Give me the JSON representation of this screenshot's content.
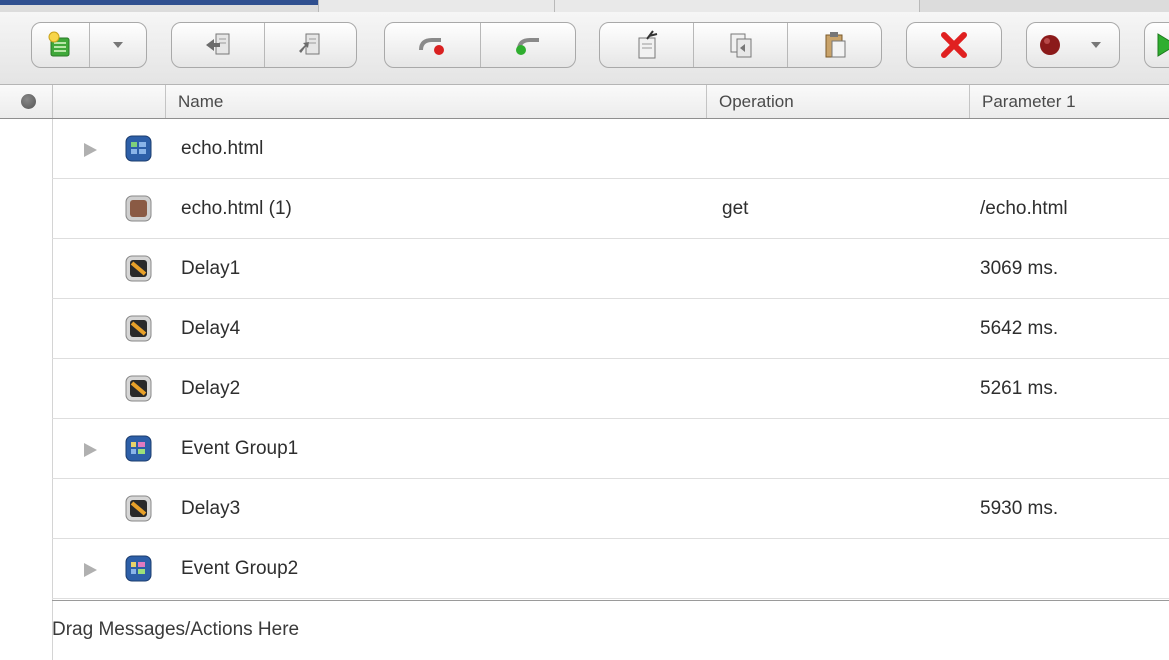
{
  "columns": {
    "name": "Name",
    "operation": "Operation",
    "parameter1": "Parameter 1"
  },
  "toolbar": {
    "groups": [
      [
        "new-item-icon",
        "dropdown-arrow-icon"
      ],
      [
        "import-icon",
        "export-icon"
      ],
      [
        "red-dot-connector-icon",
        "green-dot-connector-icon"
      ],
      [
        "cut-icon",
        "copy-icon",
        "paste-icon"
      ],
      [
        "delete-icon"
      ],
      [
        "record-icon",
        "dropdown-arrow-icon"
      ],
      [
        "play-icon"
      ]
    ]
  },
  "rows": [
    {
      "name": "echo.html",
      "operation": "",
      "parameter1": "",
      "type": "group",
      "expandable": true
    },
    {
      "name": "echo.html (1)",
      "operation": "get",
      "parameter1": "/echo.html",
      "type": "message",
      "expandable": false
    },
    {
      "name": "Delay1",
      "operation": "",
      "parameter1": "3069 ms.",
      "type": "delay",
      "expandable": false
    },
    {
      "name": "Delay4",
      "operation": "",
      "parameter1": "5642 ms.",
      "type": "delay",
      "expandable": false
    },
    {
      "name": "Delay2",
      "operation": "",
      "parameter1": "5261 ms.",
      "type": "delay",
      "expandable": false
    },
    {
      "name": "Event Group1",
      "operation": "",
      "parameter1": "",
      "type": "event-group",
      "expandable": true
    },
    {
      "name": "Delay3",
      "operation": "",
      "parameter1": "5930 ms.",
      "type": "delay",
      "expandable": false
    },
    {
      "name": "Event Group2",
      "operation": "",
      "parameter1": "",
      "type": "event-group",
      "expandable": true
    }
  ],
  "dropzone": {
    "label": "Drag Messages/Actions Here"
  },
  "colors": {
    "delete": "#e02020",
    "record": "#8b1a1a",
    "play": "#2fae2f",
    "tab_active": "#2f4f8f"
  }
}
